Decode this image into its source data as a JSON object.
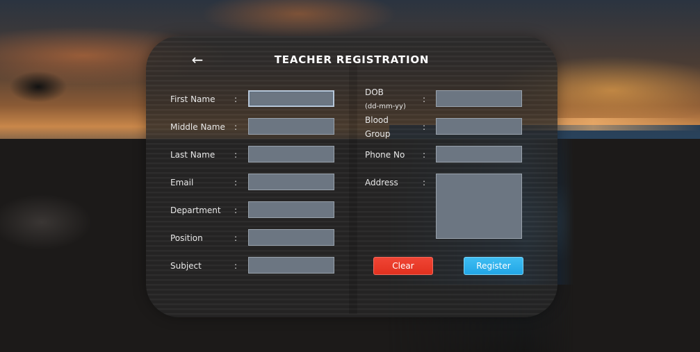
{
  "window": {
    "title": "TEACHER REGISTRATION",
    "back_icon": "←"
  },
  "form": {
    "left": [
      {
        "label": "First Name",
        "value": ""
      },
      {
        "label": "Middle Name",
        "value": ""
      },
      {
        "label": "Last Name",
        "value": ""
      },
      {
        "label": "Email",
        "value": ""
      },
      {
        "label": "Department",
        "value": ""
      },
      {
        "label": "Position",
        "value": ""
      },
      {
        "label": "Subject",
        "value": ""
      }
    ],
    "right": {
      "dob": {
        "label": "DOB",
        "hint": "(dd-mm-yy)",
        "value": ""
      },
      "blood_group": {
        "label_line1": "Blood",
        "label_line2": "Group",
        "value": ""
      },
      "phone": {
        "label": "Phone No",
        "value": ""
      },
      "address": {
        "label": "Address",
        "value": ""
      }
    },
    "colon": ":"
  },
  "buttons": {
    "clear": "Clear",
    "register": "Register"
  },
  "colors": {
    "clear_button": "#e2311f",
    "register_button": "#22a6e6",
    "field_bg": "#6c7682",
    "panel_bg": "#282828"
  }
}
